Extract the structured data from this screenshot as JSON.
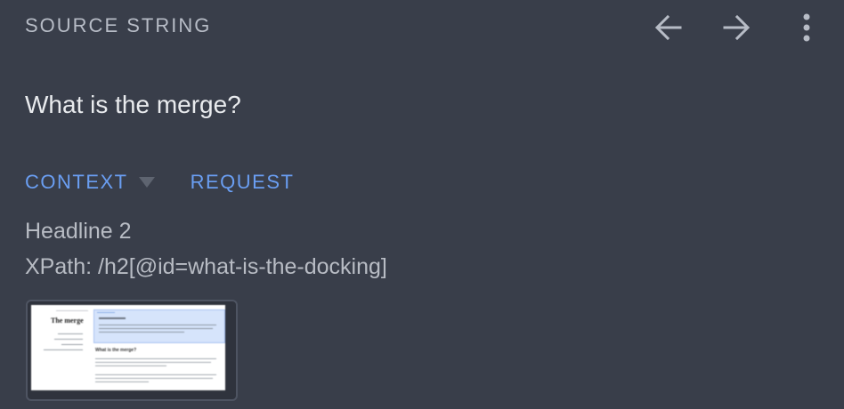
{
  "header": {
    "title": "SOURCE STRING",
    "back_icon": "arrow-left-icon",
    "forward_icon": "arrow-right-icon",
    "menu_icon": "more-vertical-icon"
  },
  "source": {
    "text": "What is the merge?"
  },
  "tabs": [
    {
      "label": "CONTEXT",
      "has_dropdown": true
    },
    {
      "label": "REQUEST",
      "has_dropdown": false
    }
  ],
  "context": {
    "element_type": "Headline 2",
    "xpath": "XPath: /h2[@id=what-is-the-docking]"
  },
  "screenshot_thumbnail": {
    "page_title": "The merge",
    "section_title": "What is the merge?"
  },
  "colors": {
    "background": "#393e4a",
    "accent": "#6a9ef2",
    "text_primary": "#e9ebee",
    "text_secondary": "#b8bcc4"
  }
}
